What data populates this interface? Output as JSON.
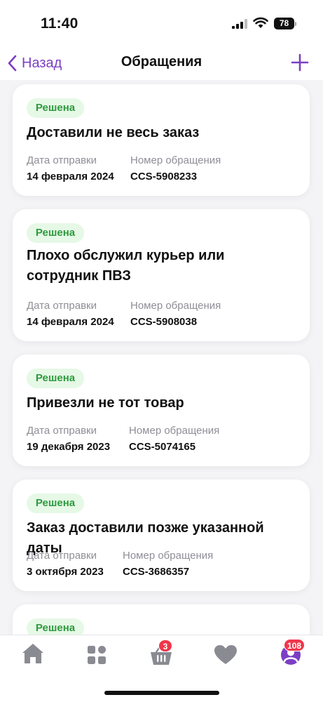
{
  "status_bar": {
    "time": "11:40",
    "battery": "78"
  },
  "nav": {
    "back_label": "Назад",
    "title": "Обращения"
  },
  "labels": {
    "date": "Дата отправки",
    "number": "Номер обращения"
  },
  "tickets": [
    {
      "status": "Решена",
      "title": "Доставили не весь заказ",
      "date": "14 февраля 2024",
      "number": "CCS-5908233"
    },
    {
      "status": "Решена",
      "title": "Плохо обслужил курьер или сотрудник ПВЗ",
      "date": "14 февраля 2024",
      "number": "CCS-5908038"
    },
    {
      "status": "Решена",
      "title": "Привезли не тот товар",
      "date": "19 декабря 2023",
      "number": "CCS-5074165"
    },
    {
      "status": "Решена",
      "title": "Заказ доставили позже указанной даты",
      "date": "3 октября 2023",
      "number": "CCS-3686357"
    },
    {
      "status": "Решена"
    }
  ],
  "tab_bar": {
    "cart_badge": "3",
    "profile_badge": "108"
  },
  "colors": {
    "accent": "#7b3fc4",
    "status_bg": "#e6f8e6",
    "status_text": "#2f9a3f",
    "badge": "#f0364a",
    "icon_gray": "#8a8a92"
  }
}
